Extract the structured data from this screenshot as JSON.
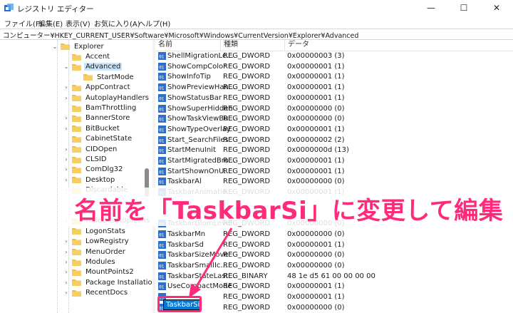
{
  "window": {
    "title": "レジストリ エディター",
    "minimize": "—",
    "maximize": "☐",
    "close": "✕"
  },
  "menu": [
    "ファイル(F)",
    "編集(E)",
    "表示(V)",
    "お気に入り(A)",
    "ヘルプ(H)"
  ],
  "address": "コンピューター¥HKEY_CURRENT_USER¥Software¥Microsoft¥Windows¥CurrentVersion¥Explorer¥Advanced",
  "tree": [
    {
      "label": "Explorer",
      "chev": "⌄",
      "level": 0
    },
    {
      "label": "Accent",
      "chev": "",
      "level": 1
    },
    {
      "label": "Advanced",
      "chev": "⌄",
      "level": 1,
      "selected": true
    },
    {
      "label": "StartMode",
      "chev": "",
      "level": 2
    },
    {
      "label": "AppContract",
      "chev": "›",
      "level": 1
    },
    {
      "label": "AutoplayHandlers",
      "chev": "›",
      "level": 1
    },
    {
      "label": "BamThrottling",
      "chev": "",
      "level": 1
    },
    {
      "label": "BannerStore",
      "chev": "›",
      "level": 1
    },
    {
      "label": "BitBucket",
      "chev": "›",
      "level": 1
    },
    {
      "label": "CabinetState",
      "chev": "",
      "level": 1
    },
    {
      "label": "CIDOpen",
      "chev": "›",
      "level": 1
    },
    {
      "label": "CLSID",
      "chev": "›",
      "level": 1
    },
    {
      "label": "ComDlg32",
      "chev": "›",
      "level": 1
    },
    {
      "label": "Desktop",
      "chev": "›",
      "level": 1
    },
    {
      "label": "Discardable",
      "chev": "›",
      "level": 1
    },
    {
      "label": "",
      "chev": "",
      "level": 1
    },
    {
      "label": "",
      "chev": "",
      "level": 1
    },
    {
      "label": "HideDesktopIcons",
      "chev": "›",
      "level": 1
    },
    {
      "label": "LogonStats",
      "chev": "",
      "level": 1
    },
    {
      "label": "LowRegistry",
      "chev": "›",
      "level": 1
    },
    {
      "label": "MenuOrder",
      "chev": "›",
      "level": 1
    },
    {
      "label": "Modules",
      "chev": "›",
      "level": 1
    },
    {
      "label": "MountPoints2",
      "chev": "›",
      "level": 1
    },
    {
      "label": "Package Installation",
      "chev": "›",
      "level": 1
    },
    {
      "label": "RecentDocs",
      "chev": "›",
      "level": 1
    }
  ],
  "columns": {
    "name": "名前",
    "type": "種類",
    "data": "データ"
  },
  "values": [
    {
      "name": "ShellMigrationLe...",
      "type": "REG_DWORD",
      "data": "0x00000003 (3)"
    },
    {
      "name": "ShowCompColor",
      "type": "REG_DWORD",
      "data": "0x00000001 (1)"
    },
    {
      "name": "ShowInfoTip",
      "type": "REG_DWORD",
      "data": "0x00000001 (1)"
    },
    {
      "name": "ShowPreviewHan...",
      "type": "REG_DWORD",
      "data": "0x00000001 (1)"
    },
    {
      "name": "ShowStatusBar",
      "type": "REG_DWORD",
      "data": "0x00000001 (1)"
    },
    {
      "name": "ShowSuperHidden",
      "type": "REG_DWORD",
      "data": "0x00000000 (0)"
    },
    {
      "name": "ShowTaskViewBu...",
      "type": "REG_DWORD",
      "data": "0x00000000 (0)"
    },
    {
      "name": "ShowTypeOverlay",
      "type": "REG_DWORD",
      "data": "0x00000001 (1)"
    },
    {
      "name": "Start_SearchFiles",
      "type": "REG_DWORD",
      "data": "0x00000002 (2)"
    },
    {
      "name": "StartMenuInit",
      "type": "REG_DWORD",
      "data": "0x0000000d (13)"
    },
    {
      "name": "StartMigratedBro...",
      "type": "REG_DWORD",
      "data": "0x00000001 (1)"
    },
    {
      "name": "StartShownOnU...",
      "type": "REG_DWORD",
      "data": "0x00000001 (1)"
    },
    {
      "name": "TaskbarAl",
      "type": "REG_DWORD",
      "data": "0x00000000 (0)"
    },
    {
      "name": "TaskbarAnimatio...",
      "type": "REG_DWORD",
      "data": "0x00000001 (1)"
    },
    {
      "name": "",
      "type": "",
      "data": ""
    },
    {
      "name": "",
      "type": "",
      "data": ""
    },
    {
      "name": "TaskbarGlomLevel",
      "type": "REG_DWORD",
      "data": "0x00000000 (0)"
    },
    {
      "name": "TaskbarMn",
      "type": "REG_DWORD",
      "data": "0x00000000 (0)"
    },
    {
      "name": "TaskbarSd",
      "type": "REG_DWORD",
      "data": "0x00000001 (1)"
    },
    {
      "name": "TaskbarSizeMove",
      "type": "REG_DWORD",
      "data": "0x00000000 (0)"
    },
    {
      "name": "TaskbarSmallIc...",
      "type": "REG_DWORD",
      "data": "0x00000000 (0)"
    },
    {
      "name": "TaskbarStateLast...",
      "type": "REG_BINARY",
      "data": "48 1e d5 61 00 00 00 00"
    },
    {
      "name": "UseCompactMode",
      "type": "REG_DWORD",
      "data": "0x00000001 (1)"
    },
    {
      "name": "",
      "type": "REG_DWORD",
      "data": "0x00000001 (1)"
    },
    {
      "name": "",
      "type": "REG_DWORD",
      "data": "0x00000000 (0)"
    }
  ],
  "edit_value": "TaskbarSi",
  "annotation": "名前を「TaskbarSi」に変更して編集",
  "colors": {
    "accent": "#ff2a7a",
    "selection": "#0078d7",
    "folder": "#f0c04c"
  }
}
